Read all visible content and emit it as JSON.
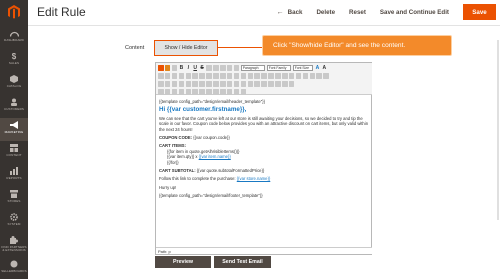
{
  "header": {
    "title": "Edit Rule",
    "back_label": "Back",
    "delete_label": "Delete",
    "reset_label": "Reset",
    "save_continue_label": "Save and Continue Edit",
    "save_label": "Save"
  },
  "sidebar": {
    "items": [
      {
        "label": "Dashboard",
        "icon": "dashboard-icon"
      },
      {
        "label": "Sales",
        "icon": "dollar-icon"
      },
      {
        "label": "Catalog",
        "icon": "cube-icon"
      },
      {
        "label": "Customers",
        "icon": "user-icon"
      },
      {
        "label": "Marketing",
        "icon": "megaphone-icon"
      },
      {
        "label": "Content",
        "icon": "layout-icon"
      },
      {
        "label": "Reports",
        "icon": "chart-icon"
      },
      {
        "label": "Stores",
        "icon": "store-icon"
      },
      {
        "label": "System",
        "icon": "gear-icon"
      },
      {
        "label": "Find Partners & Extensions",
        "icon": "puzzle-icon"
      },
      {
        "label": "Sellerboards",
        "icon": "board-icon"
      }
    ],
    "active_index": 4
  },
  "form": {
    "content_label": "Content",
    "show_hide_label": "Show / Hide Editor"
  },
  "callout": {
    "text": "Click \"Show/hide Editor\" and see the content."
  },
  "toolbar": {
    "paragraph": "Paragraph",
    "font_family": "Font Family",
    "font_size": "Font Size"
  },
  "editor": {
    "line1": "{{template config_path=\"design/email/header_template\"}}",
    "heading": "Hi {{var customer.firstname}},",
    "intro": "We can see that the cart you've left at our store is still awaiting your decisions, so we decided to try and tip the scale in our favor. Coupon code below provides you with an attractive discount on cart items, but only valid within the next 24 hours!",
    "coupon_label": "COUPON CODE:",
    "coupon_value": "{{var coupon.code}}",
    "cart_items_label": "CART ITEMS:",
    "for_item": "{{for item in quote.getAllVisibleItems()}}",
    "item_qty": "{{var item.qty}} x ",
    "item_name": "{{var item.name}}",
    "endfor": "{{/for}}",
    "subtotal_label": "CART SUBTOTAL:",
    "subtotal_value": "{{var quote.subtotalFormattedPrice}}",
    "follow_text": "Follow this link to complete the purchase: ",
    "follow_link": "{{var store.name}}",
    "hurry": "Hurry up!",
    "footer": "{{template config_path=\"design/email/footer_template\"}}",
    "path": "Path: p"
  },
  "buttons": {
    "preview": "Preview",
    "send_test": "Send Test Email"
  },
  "colors": {
    "accent": "#eb5202",
    "sidebar_bg": "#373330",
    "callout_bg": "#f38a2a",
    "link": "#1979c3",
    "button_dark": "#514943"
  }
}
